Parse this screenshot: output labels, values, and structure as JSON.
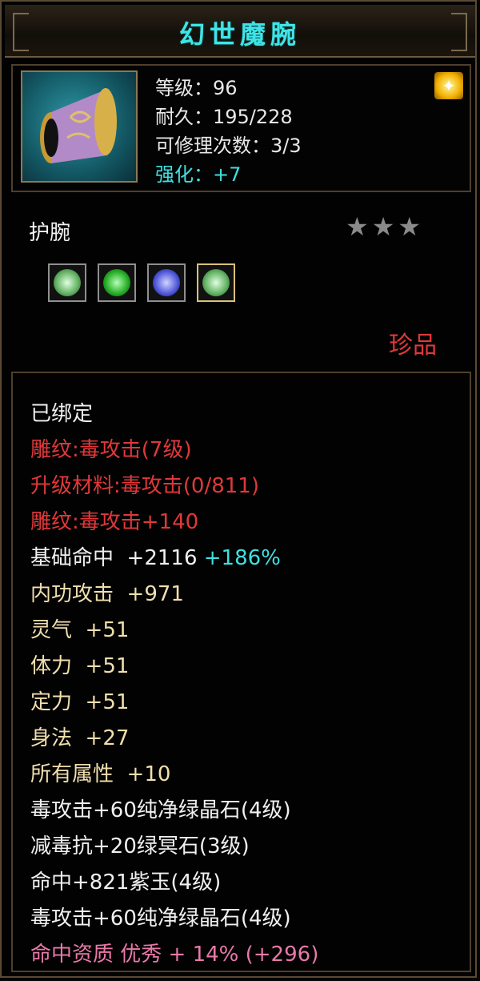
{
  "title": "幻世魔腕",
  "stats": {
    "level": "等级：96",
    "durability": "耐久：195/228",
    "repair": "可修理次数：3/3",
    "enhance": "强化：+7"
  },
  "slot": "护腕",
  "stars": "★★★",
  "rarity": "珍品",
  "gems": [
    {
      "color": "#8fd08f"
    },
    {
      "color": "#2fbf2f"
    },
    {
      "color": "#4c54d8"
    },
    {
      "color": "#8fd08f"
    }
  ],
  "attributes": {
    "bound": "已绑定",
    "engrave1": "雕纹:毒攻击(7级)",
    "upgrade": "升级材料:毒攻击(0/811)",
    "engrave2": "雕纹:毒攻击+140",
    "hit_label": "基础命中  +2116",
    "hit_pct": "+186%",
    "inner_atk": "内功攻击  +971",
    "spirit": "灵气  +51",
    "stamina": "体力  +51",
    "focus": "定力  +51",
    "agility": "身法  +27",
    "all_attr": "所有属性  +10",
    "gem_line1": "毒攻击+60纯净绿晶石(4级)",
    "gem_line2": "减毒抗+20绿冥石(3级)",
    "gem_line3": "命中+821紫玉(4级)",
    "gem_line4": "毒攻击+60纯净绿晶石(4级)",
    "aptitude": "命中资质 优秀 + 14% (+296)"
  }
}
